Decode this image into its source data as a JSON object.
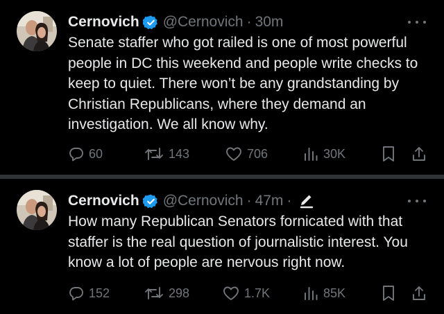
{
  "tweets": [
    {
      "author": {
        "name": "Cernovich",
        "handle": "@Cernovich",
        "verified": true,
        "avatar_icon": "avatar-photo"
      },
      "time": "30m",
      "edited": false,
      "text": "Senate staffer who got railed is one of most powerful people in DC this weekend and people write checks to keep to quiet. There won’t be any grandstanding by Christian Republicans, where they demand an investigation. We all know why.",
      "stats": {
        "replies": "60",
        "reposts": "143",
        "likes": "706",
        "views": "30K"
      }
    },
    {
      "author": {
        "name": "Cernovich",
        "handle": "@Cernovich",
        "verified": true,
        "avatar_icon": "avatar-photo"
      },
      "time": "47m",
      "edited": true,
      "text": "How many Republican Senators fornicated with that staffer is the real question of journalistic interest. You know a lot of people are nervous right now.",
      "stats": {
        "replies": "152",
        "reposts": "298",
        "likes": "1.7K",
        "views": "85K"
      }
    }
  ],
  "separator": "·",
  "colors": {
    "background": "#000000",
    "text": "#e7e9ea",
    "muted": "#71767b",
    "verified_blue": "#1d9bf0",
    "divider": "#2f3336"
  },
  "icons": [
    "reply-icon",
    "repost-icon",
    "like-icon",
    "views-icon",
    "bookmark-icon",
    "share-icon",
    "more-icon",
    "verified-badge-icon",
    "edited-pencil-icon"
  ]
}
